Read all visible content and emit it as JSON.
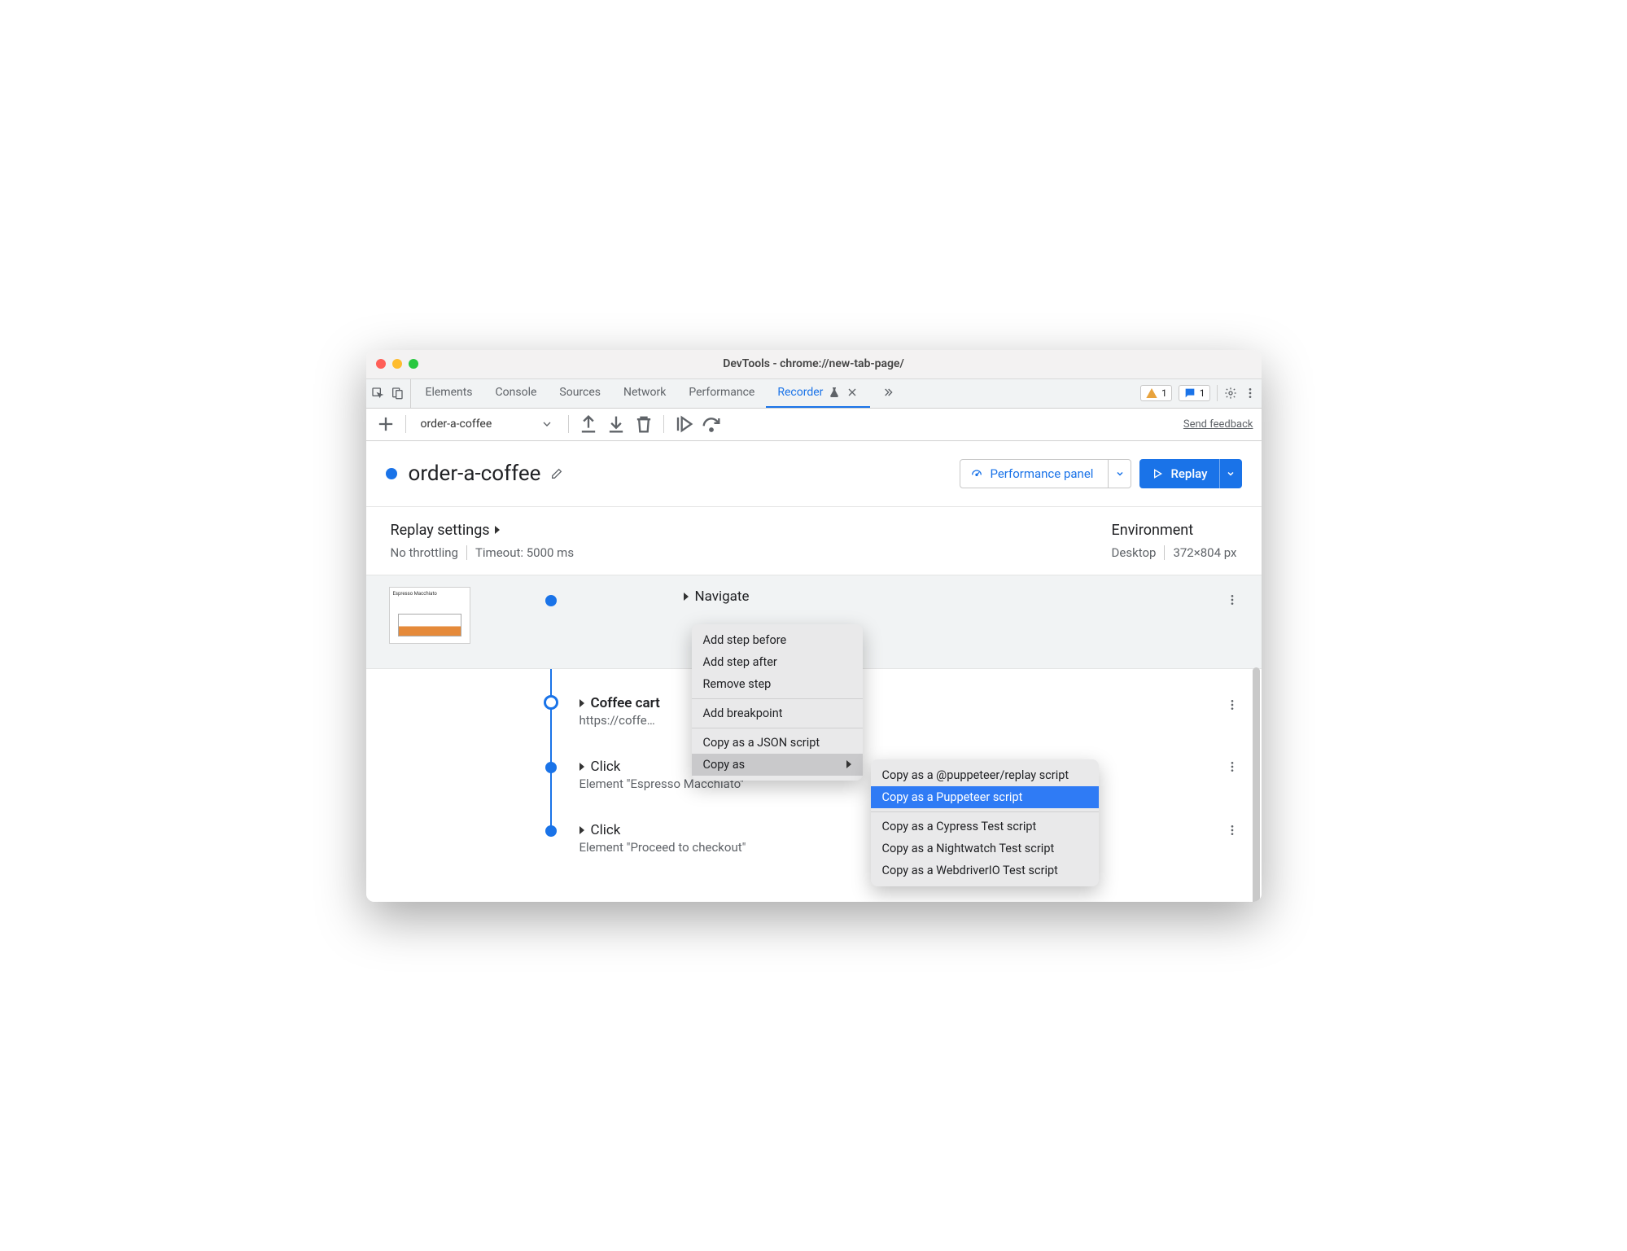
{
  "window": {
    "title": "DevTools - chrome://new-tab-page/"
  },
  "tabs": {
    "items": [
      "Elements",
      "Console",
      "Sources",
      "Network",
      "Performance",
      "Recorder"
    ],
    "active_index": 5,
    "warn_count": "1",
    "issue_count": "1"
  },
  "toolbar": {
    "recording_name": "order-a-coffee",
    "feedback": "Send feedback"
  },
  "header": {
    "title": "order-a-coffee",
    "perf_button": "Performance panel",
    "replay_button": "Replay"
  },
  "settings": {
    "replay_title": "Replay settings",
    "throttling": "No throttling",
    "timeout": "Timeout: 5000 ms",
    "env_title": "Environment",
    "device": "Desktop",
    "viewport": "372×804 px"
  },
  "steps": [
    {
      "title": "Navigate",
      "bold": false,
      "sub": "",
      "thumb": true
    },
    {
      "title": "Coffee cart",
      "bold": true,
      "sub": "https://coffe…",
      "thumb": false
    },
    {
      "title": "Click",
      "bold": false,
      "sub": "Element \"Espresso Macchiato\"",
      "thumb": false
    },
    {
      "title": "Click",
      "bold": false,
      "sub": "Element \"Proceed to checkout\"",
      "thumb": false
    }
  ],
  "thumb_label": "Espresso Macchiato",
  "context_menu": {
    "items": [
      {
        "label": "Add step before"
      },
      {
        "label": "Add step after"
      },
      {
        "label": "Remove step"
      },
      {
        "sep": true
      },
      {
        "label": "Add breakpoint"
      },
      {
        "sep": true
      },
      {
        "label": "Copy as a JSON script"
      },
      {
        "label": "Copy as",
        "submenu": true,
        "hovered": true
      }
    ],
    "submenu": [
      {
        "label": "Copy as a @puppeteer/replay script"
      },
      {
        "label": "Copy as a Puppeteer script",
        "highlight": true
      },
      {
        "sep": true
      },
      {
        "label": "Copy as a Cypress Test script"
      },
      {
        "label": "Copy as a Nightwatch Test script"
      },
      {
        "label": "Copy as a WebdriverIO Test script"
      }
    ]
  }
}
